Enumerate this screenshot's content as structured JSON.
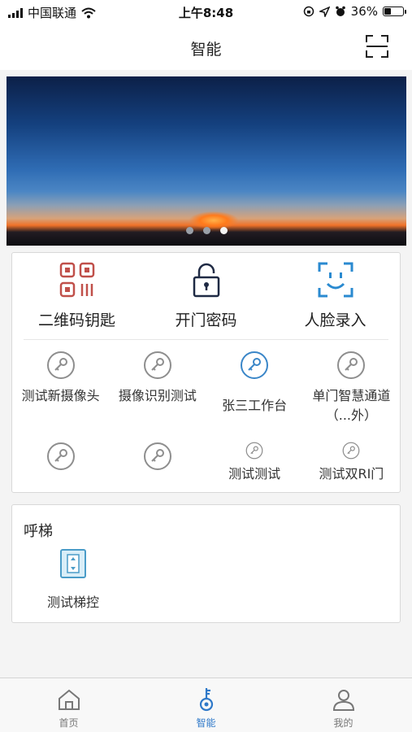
{
  "status_bar": {
    "carrier": "中国联通",
    "time": "上午8:48",
    "battery": "36%",
    "battery_level": 0.36
  },
  "nav": {
    "title": "智能",
    "scan_icon": "scan-icon"
  },
  "banner": {
    "slides": 3,
    "active_slide": 3
  },
  "quick_actions": [
    {
      "label": "二维码钥匙",
      "icon": "qr-code-icon",
      "color": "#c0504a"
    },
    {
      "label": "开门密码",
      "icon": "lock-icon",
      "color": "#1f2a44"
    },
    {
      "label": "人脸录入",
      "icon": "face-scan-icon",
      "color": "#2a8ad0"
    }
  ],
  "door_keys": [
    {
      "label": "测试新摄像头",
      "icon": "key-icon"
    },
    {
      "label": "摄像识别测试",
      "icon": "key-icon"
    },
    {
      "label": "张三工作台",
      "icon": "key-icon",
      "highlight": true
    },
    {
      "label": "单门智慧通道（...外）",
      "icon": "key-icon"
    },
    {
      "label": "",
      "icon": "key-icon"
    },
    {
      "label": "",
      "icon": "key-icon"
    },
    {
      "label": "测试测试",
      "icon": "key-icon"
    },
    {
      "label": "测试双RI门",
      "icon": "key-icon"
    }
  ],
  "elevator": {
    "title": "呼梯",
    "item_label": "测试梯控",
    "item_icon": "elevator-icon"
  },
  "tabs": [
    {
      "label": "首页",
      "icon": "home-icon",
      "active": false
    },
    {
      "label": "智能",
      "icon": "smart-key-icon",
      "active": true
    },
    {
      "label": "我的",
      "icon": "person-icon",
      "active": false
    }
  ],
  "colors": {
    "accent": "#2f79c9",
    "key_gray": "#8e8e8e",
    "key_highlight": "#3a86c8"
  }
}
